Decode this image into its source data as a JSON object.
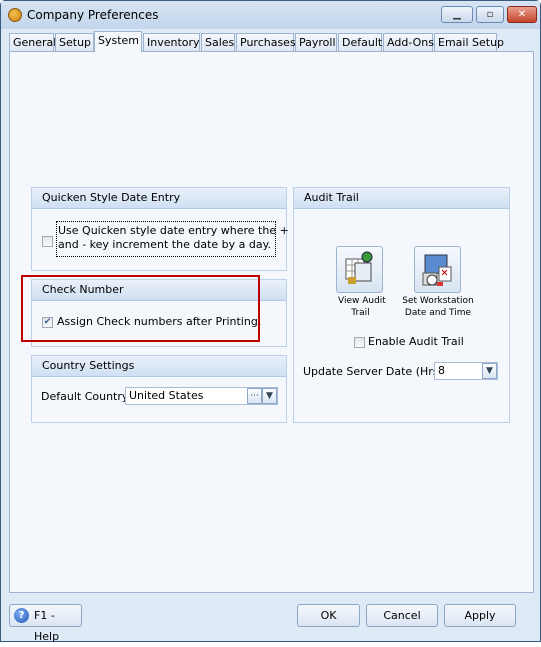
{
  "window": {
    "title": "Company Preferences",
    "minimize": "▁",
    "maximize": "▫",
    "close": "✕"
  },
  "tabs": [
    {
      "label": "General"
    },
    {
      "label": "Setup"
    },
    {
      "label": "System",
      "active": true
    },
    {
      "label": "Inventory"
    },
    {
      "label": "Sales"
    },
    {
      "label": "Purchases"
    },
    {
      "label": "Payroll"
    },
    {
      "label": "Default"
    },
    {
      "label": "Add-Ons"
    },
    {
      "label": "Email Setup"
    }
  ],
  "quicken": {
    "title": "Quicken Style Date Entry",
    "checkbox_label_1": "Use Quicken style date entry where the +",
    "checkbox_label_2": "and - key increment the date by a day.",
    "checked": false
  },
  "check_number": {
    "title": "Check Number",
    "checkbox_label": "Assign Check numbers after Printing.",
    "checked": true,
    "highlight_color": "#c00000"
  },
  "country": {
    "title": "Country Settings",
    "label": "Default Country",
    "value": "United States",
    "ellipsis": "···",
    "arrow": "▼"
  },
  "audit": {
    "title": "Audit Trail",
    "view_label_1": "View Audit",
    "view_label_2": "Trail",
    "set_label_1": "Set Workstation",
    "set_label_2": "Date and Time",
    "enable_label": "Enable Audit Trail",
    "enable_checked": false,
    "update_label": "Update Server Date (Hrs)",
    "update_value": "8",
    "arrow": "▼"
  },
  "footer": {
    "help": "F1 - Help",
    "help_icon": "?",
    "ok": "OK",
    "cancel": "Cancel",
    "apply": "Apply"
  }
}
